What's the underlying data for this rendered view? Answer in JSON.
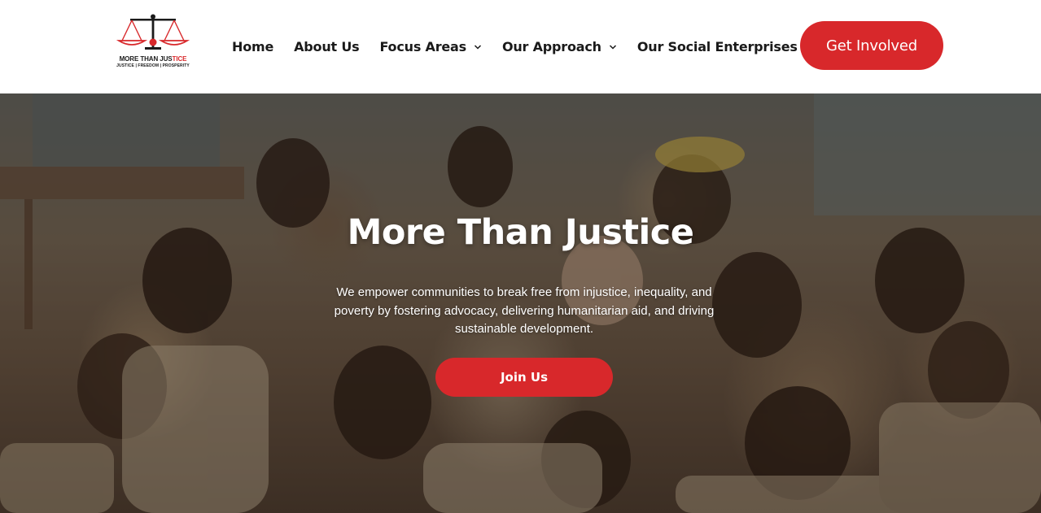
{
  "brand": {
    "name_part1": "MORE THAN JUS",
    "name_part2": "TICE",
    "tagline": "JUSTICE | FREEDOM | PROSPERITY",
    "colors": {
      "accent": "#d8282b",
      "dark": "#1b1b1b"
    }
  },
  "nav": {
    "items": [
      {
        "label": "Home",
        "has_dropdown": false
      },
      {
        "label": "About Us",
        "has_dropdown": false
      },
      {
        "label": "Focus Areas",
        "has_dropdown": true
      },
      {
        "label": "Our Approach",
        "has_dropdown": true
      },
      {
        "label": "Our Social Enterprises",
        "has_dropdown": true
      }
    ],
    "cta_label": "Get Involved"
  },
  "hero": {
    "title": "More Than Justice",
    "description": "We empower communities to break free from injustice, inequality, and poverty by fostering advocacy, delivering humanitarian aid, and driving sustainable development.",
    "button_label": "Join Us",
    "background_image": "photo of smiling children in a classroom"
  },
  "icons": {
    "logo": "scales-of-justice-icon",
    "dropdown": "chevron-down-icon"
  }
}
